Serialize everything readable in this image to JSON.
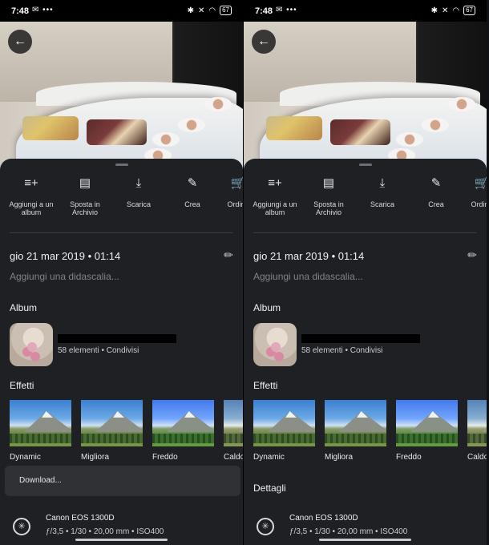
{
  "status_bar": {
    "time": "7:48",
    "notif_icons": "✉ •••",
    "battery": "67"
  },
  "actions": [
    {
      "label": "Aggiungi a un album",
      "icon": "playlist-add-icon"
    },
    {
      "label": "Sposta in Archivio",
      "icon": "archive-icon"
    },
    {
      "label": "Scarica",
      "icon": "download-icon"
    },
    {
      "label": "Crea",
      "icon": "brush-icon"
    },
    {
      "label": "Ordina",
      "icon": "cart-icon"
    }
  ],
  "date_time": "gio 21 mar 2019  •  01:14",
  "caption_placeholder": "Aggiungi una didascalia...",
  "album": {
    "title": "Album",
    "subtitle": "58 elementi • Condivisi"
  },
  "effects": {
    "title": "Effetti",
    "items": [
      "Dynamic",
      "Migliora",
      "Freddo",
      "Caldo"
    ]
  },
  "toast": "Download...",
  "details": {
    "title": "Dettagli"
  },
  "camera": {
    "name": "Canon EOS 1300D",
    "meta": "ƒ/3,5  •  1/30  •  20,00 mm  •  ISO400"
  }
}
